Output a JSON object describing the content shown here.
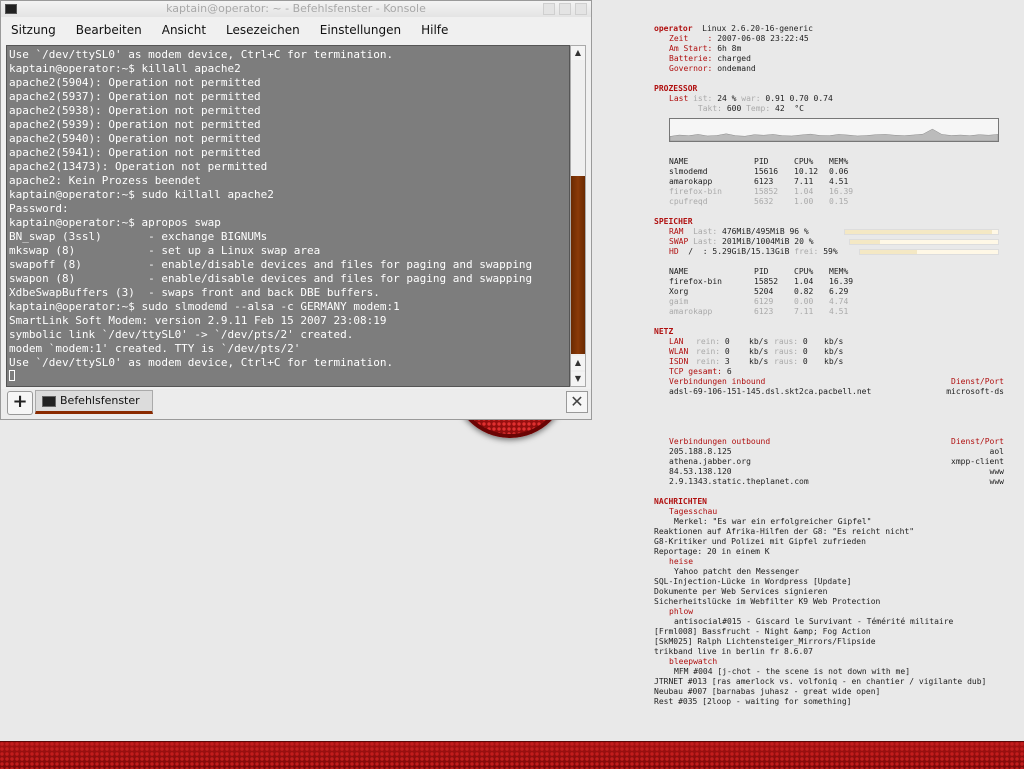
{
  "window": {
    "title": "kaptain@operator: ~ - Befehlsfenster - Konsole",
    "menu": [
      "Sitzung",
      "Bearbeiten",
      "Ansicht",
      "Lesezeichen",
      "Einstellungen",
      "Hilfe"
    ],
    "tab_label": "Befehlsfenster",
    "terminal_lines": [
      "Use `/dev/ttySL0' as modem device, Ctrl+C for termination.",
      "kaptain@operator:~$ killall apache2",
      "apache2(5904): Operation not permitted",
      "apache2(5937): Operation not permitted",
      "apache2(5938): Operation not permitted",
      "apache2(5939): Operation not permitted",
      "apache2(5940): Operation not permitted",
      "apache2(5941): Operation not permitted",
      "apache2(13473): Operation not permitted",
      "apache2: Kein Prozess beendet",
      "kaptain@operator:~$ sudo killall apache2",
      "Password:",
      "kaptain@operator:~$ apropos swap",
      "BN_swap (3ssl)       - exchange BIGNUMs",
      "mkswap (8)           - set up a Linux swap area",
      "swapoff (8)          - enable/disable devices and files for paging and swapping",
      "swapon (8)           - enable/disable devices and files for paging and swapping",
      "XdbeSwapBuffers (3)  - swaps front and back DBE buffers.",
      "kaptain@operator:~$ sudo slmodemd --alsa -c GERMANY modem:1",
      "SmartLink Soft Modem: version 2.9.11 Feb 15 2007 23:08:19",
      "symbolic link `/dev/ttySL0' -> `/dev/pts/2' created.",
      "modem `modem:1' created. TTY is `/dev/pts/2'",
      "Use `/dev/ttySL0' as modem device, Ctrl+C for termination."
    ]
  },
  "conky": {
    "host": "operator",
    "kernel": "Linux 2.6.20-16-generic",
    "zeit_label": "Zeit    :",
    "zeit": "2007-06-08 23:22:45",
    "am_start_label": "Am Start:",
    "am_start": "6h 8m",
    "batterie_label": "Batterie:",
    "batterie": "charged",
    "governor_label": "Governor:",
    "governor": "ondemand",
    "prozessor_head": "PROZESSOR",
    "last_label": "Last",
    "ist_label": "ist:",
    "cpu_ist": "24 %",
    "war_label": "war:",
    "cpu_war": "0.91 0.70 0.74",
    "takt_label": "Takt:",
    "takt": "600",
    "temp_label": "Temp:",
    "temp": "42",
    "temp_unit": "°C",
    "cpu_graph": [
      0.35,
      0.45,
      0.4,
      0.5,
      0.38,
      0.42,
      0.55,
      0.4,
      0.36,
      0.48,
      0.44,
      0.5,
      0.4,
      0.38,
      0.46,
      0.52,
      0.42,
      0.4,
      0.5,
      0.45,
      0.38,
      0.42,
      0.48,
      0.5,
      0.44,
      0.4,
      0.46,
      0.52,
      0.9,
      0.5,
      0.42,
      0.45,
      0.4,
      0.48,
      0.44,
      0.5
    ],
    "proc_headers": [
      "NAME",
      "PID",
      "CPU%",
      "MEM%"
    ],
    "cpu_procs": [
      [
        "slmodemd",
        "15616",
        "10.12",
        "0.06"
      ],
      [
        "amarokapp",
        "6123",
        "7.11",
        "4.51"
      ],
      [
        "firefox-bin",
        "15852",
        "1.04",
        "16.39"
      ],
      [
        "cpufreqd",
        "5632",
        "1.00",
        "0.15"
      ]
    ],
    "speicher_head": "SPEICHER",
    "ram_label": "RAM",
    "ram_last_label": "Last:",
    "ram": "476MiB/495MiB 96 %",
    "ram_frac": 0.96,
    "swap_label": "SWAP",
    "swap_last_label": "Last:",
    "swap": "201MiB/1004MiB 20 %",
    "swap_frac": 0.2,
    "hd_label": "HD",
    "hd_path": "/  :",
    "hd": "5.29GiB/15.13GiB",
    "hd_frei_label": "frei:",
    "hd_frei": "59%",
    "hd_frac": 0.41,
    "mem_procs": [
      [
        "firefox-bin",
        "15852",
        "1.04",
        "16.39"
      ],
      [
        "Xorg",
        "5204",
        "0.82",
        "6.29"
      ],
      [
        "gaim",
        "6129",
        "0.00",
        "4.74"
      ],
      [
        "amarokapp",
        "6123",
        "7.11",
        "4.51"
      ]
    ],
    "netz_head": "NETZ",
    "lan_label": "LAN",
    "wlan_label": "WLAN",
    "isdn_label": "ISDN",
    "rein_label": "rein:",
    "raus_label": "raus:",
    "kbs_unit": "kb/s",
    "lan_rein": "0",
    "lan_raus": "0",
    "wlan_rein": "0",
    "wlan_raus": "0",
    "isdn_rein": "3",
    "isdn_raus": "0",
    "tcp_label": "TCP gesamt:",
    "tcp": "6",
    "inbound_label": "Verbindungen inbound",
    "dienst_port_label": "Dienst/Port",
    "inbound": [
      [
        "adsl-69-106-151-145.dsl.skt2ca.pacbell.net",
        "microsoft-ds"
      ]
    ],
    "outbound_label": "Verbindungen outbound",
    "outbound": [
      [
        "205.188.8.125",
        "aol"
      ],
      [
        "athena.jabber.org",
        "xmpp-client"
      ],
      [
        "84.53.138.120",
        "www"
      ],
      [
        "2.9.1343.static.theplanet.com",
        "www"
      ]
    ],
    "nachrichten_head": "NACHRICHTEN",
    "news": [
      {
        "source": "Tagesschau",
        "items": [
          "Merkel: \"Es war ein erfolgreicher Gipfel\"",
          "Reaktionen auf Afrika-Hilfen der G8: \"Es reicht nicht\"",
          "G8-Kritiker und Polizei mit Gipfel zufrieden",
          "Reportage: 20 in einem K"
        ]
      },
      {
        "source": "heise",
        "items": [
          "Yahoo patcht den Messenger",
          "SQL-Injection-Lücke in Wordpress [Update]",
          "Dokumente per Web Services signieren",
          "Sicherheitslücke im Webfilter K9 Web Protection"
        ]
      },
      {
        "source": "phlow",
        "items": [
          "antisocial#015 - Giscard le Survivant - Témérité militaire",
          "[Frml008] Bassfrucht - Night &amp; Fog Action",
          "[SkM025] Ralph Lichtensteiger_Mirrors/Flipside",
          "trikband live in berlin fr 8.6.07"
        ]
      },
      {
        "source": "bleepwatch",
        "items": [
          "MFM #004 [j-chot - the scene is not down with me]",
          "JTRNET #013 [ras amerlock vs. volfoniq - en chantier / vigilante dub]",
          "Neubau #007 [barnabas juhasz - great wide open]",
          "Rest #035 [2loop - waiting for something]"
        ]
      }
    ]
  },
  "colors": {
    "accent": "#b01010",
    "terminal_bg": "#7d7d7d",
    "scroll_thumb": "#8a3a08"
  }
}
